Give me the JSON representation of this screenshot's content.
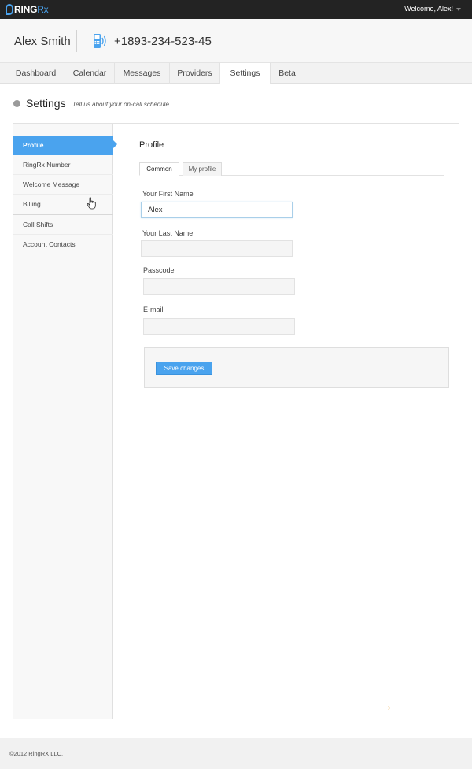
{
  "topbar": {
    "logo_main": "RING",
    "logo_accent": "Rx",
    "welcome": "Welcome, Alex!",
    "accent_color": "#4aa3ee"
  },
  "header": {
    "user_name": "Alex Smith",
    "phone_icon": "phone-signal-icon",
    "phone_number": "+1893-234-523-45"
  },
  "nav": {
    "tabs": [
      {
        "label": "Dashboard"
      },
      {
        "label": "Calendar"
      },
      {
        "label": "Messages"
      },
      {
        "label": "Providers"
      },
      {
        "label": "Settings",
        "active": true
      },
      {
        "label": "Beta"
      }
    ]
  },
  "page": {
    "title": "Settings",
    "subtitle": "Tell us about your on-call schedule"
  },
  "sidebar": {
    "items": [
      {
        "label": "Profile",
        "active": true
      },
      {
        "label": "RingRx Number"
      },
      {
        "label": "Welcome Message"
      },
      {
        "label": "Billing"
      },
      {
        "label": "Call Shifts"
      },
      {
        "label": "Account Contacts"
      }
    ]
  },
  "content": {
    "title": "Profile",
    "sub_tabs": [
      {
        "label": "Common",
        "active": true
      },
      {
        "label": "My profile"
      }
    ],
    "fields": {
      "first_name": {
        "label": "Your First Name",
        "value": "Alex"
      },
      "last_name": {
        "label": "Your Last Name",
        "value": ""
      },
      "passcode": {
        "label": "Passcode",
        "value": ""
      },
      "email": {
        "label": "E-mail",
        "value": ""
      }
    },
    "save_label": "Save changes",
    "next_glyph": "›"
  },
  "footer": {
    "copyright": "©2012 RingRX LLC."
  }
}
